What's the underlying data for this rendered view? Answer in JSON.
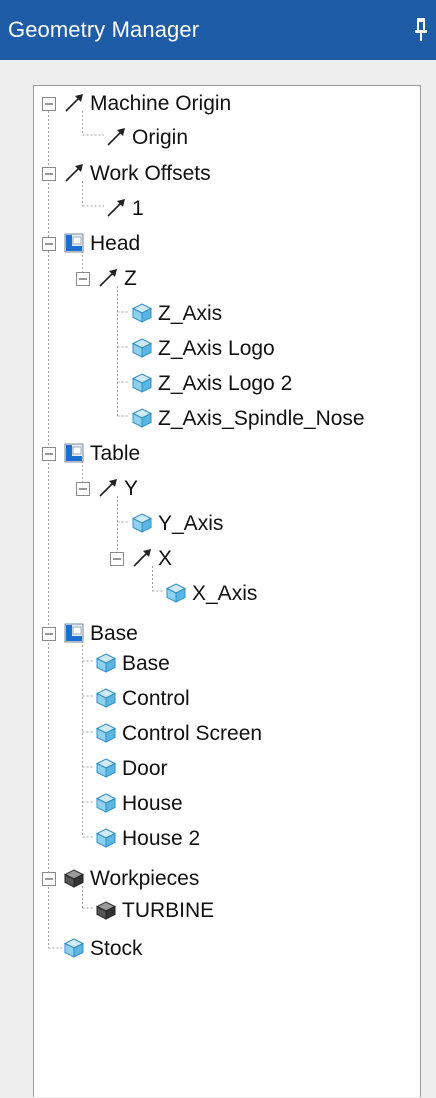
{
  "window": {
    "title": "Geometry Manager"
  },
  "colors": {
    "titlebar": "#1f5ca8",
    "panel": "#eeeeef",
    "tree_bg": "#ffffff",
    "tree_line": "#9a9a9a"
  },
  "icons": {
    "axis": "axis-arrow-icon",
    "component": "component-icon",
    "model": "model-cube-icon",
    "workpiece": "workpiece-icon",
    "pin": "pin-icon",
    "toggle": "minus-box-icon"
  },
  "tree": {
    "machine_origin": "Machine Origin",
    "origin": "Origin",
    "work_offsets": "Work Offsets",
    "offset_1": "1",
    "head": "Head",
    "z": "Z",
    "z_axis": "Z_Axis",
    "z_axis_logo": "Z_Axis Logo",
    "z_axis_logo_2": "Z_Axis Logo 2",
    "z_axis_spindle_nose": "Z_Axis_Spindle_Nose",
    "table": "Table",
    "y": "Y",
    "y_axis": "Y_Axis",
    "x": "X",
    "x_axis": "X_Axis",
    "base": "Base",
    "base_model": "Base",
    "control": "Control",
    "control_screen": "Control Screen",
    "door": "Door",
    "house": "House",
    "house_2": "House 2",
    "workpieces": "Workpieces",
    "turbine": "TURBINE",
    "stock": "Stock"
  }
}
